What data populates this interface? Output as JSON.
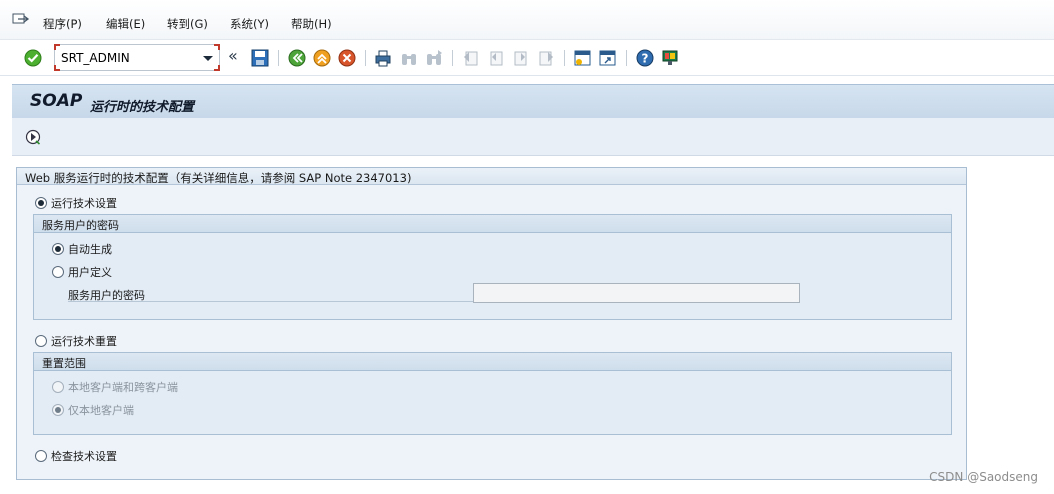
{
  "menu": {
    "items": [
      "程序(P)",
      "编辑(E)",
      "转到(G)",
      "系统(Y)",
      "帮助(H)"
    ]
  },
  "toolbar": {
    "command_value": "SRT_ADMIN",
    "icons": [
      "ok-check-icon",
      "expand-icon",
      "save-icon",
      "back-icon",
      "exit-icon",
      "cancel-icon",
      "print-icon",
      "find-icon",
      "find-next-icon",
      "first-page-icon",
      "previous-page-icon",
      "next-page-icon",
      "last-page-icon",
      "create-session-icon",
      "shortcut-icon",
      "help-icon",
      "customize-layout-icon"
    ]
  },
  "header": {
    "title_main": "SOAP",
    "title_rest": "运行时的技术配置"
  },
  "main": {
    "frame_title": "Web 服务运行时的技术配置（有关详细信息，请参阅 SAP Note 2347013)",
    "run_setup": {
      "label": "运行技术设置",
      "selected": true
    },
    "password_group": {
      "title": "服务用户的密码",
      "options": [
        {
          "label": "自动生成",
          "selected": true
        },
        {
          "label": "用户定义",
          "selected": false
        }
      ],
      "field_label": "服务用户的密码",
      "field_value": ""
    },
    "reset": {
      "label": "运行技术重置",
      "selected": false
    },
    "reset_group": {
      "title": "重置范围",
      "options": [
        {
          "label": "本地客户端和跨客户端",
          "selected": false
        },
        {
          "label": "仅本地客户端",
          "selected": true
        }
      ]
    },
    "check": {
      "label": "检查技术设置",
      "selected": false
    }
  },
  "watermark": "CSDN @Saodseng"
}
